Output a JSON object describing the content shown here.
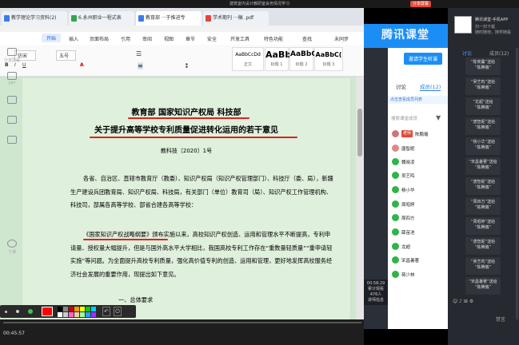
{
  "window_title": "建筑室内设计教研室会务情况学习",
  "window_button": "分享屏幕",
  "tabs": [
    {
      "label": "教学理论学习资料(2)"
    },
    {
      "label": "6.永州职业一程式表"
    },
    {
      "label": "教育部 ···于推进专"
    },
    {
      "label": "学术期刊 ···稿 .pdf"
    }
  ],
  "menu": {
    "items": [
      "开始",
      "插入",
      "页面布局",
      "引用",
      "审阅",
      "视图",
      "章节",
      "安全",
      "开发工具",
      "特色功能",
      "查找",
      "未同步"
    ]
  },
  "ribbon": {
    "font_name": "仿宋",
    "font_size": "五号",
    "styles": [
      {
        "preview": "AaBbCcDd",
        "name": "正文"
      },
      {
        "preview": "AaBb",
        "name": "标题 1"
      },
      {
        "preview": "AaBbC",
        "name": "标题 2"
      },
      {
        "preview": "AaBbC(",
        "name": "标题 3"
      }
    ]
  },
  "document": {
    "title1": "教育部 国家知识产权局 科技部",
    "title2": "关于提升高等学校专利质量促进转化运用的若干意见",
    "doc_no": "教科技〔2020〕1号",
    "para1": "各省、自治区、直辖市教育厅（教委）、知识产权局（知识产权管理部门）、科技厅（委、局），新疆生产建设兵团教育局、知识产权局、科技局，有关部门（单位）教育司（局）、知识产权工作管理机构、科技司，部属各高等学校、部省合建各高等学校：",
    "para2": "《国家知识产权战略纲要》颁布实施以来，高校知识产权创造、运用和管理水平不断提高，专利申请量、授权量大幅提升，但是与国外高水平大学相比，我国高校专利工作存在“重数量轻质量”“重申请轻实施”等问题。为全面提升高校专利质量，强化高价值专利的创造、运用和管理，更好地发挥高校服务经济社会发展的重要作用，现提出如下意见。",
    "section": "一、总体要求"
  },
  "video": {
    "elapsed": "00:45:57",
    "progress": 0.0
  },
  "classroom": {
    "brand": "腾讯课堂",
    "invite_button": "邀请学生听课",
    "left_tools": [
      "分享屏幕",
      "PPT",
      "视频",
      "播放",
      "画笔",
      "麦克风",
      "音乐",
      "设置",
      "下课"
    ],
    "live_time": "00:58:29",
    "live_text1": "累计观看",
    "live_text2": "476人",
    "live_text3": "讲师信息",
    "tab_discuss": "讨论",
    "tab_members": "成员(12)",
    "notice": "点击查看成员列表",
    "search_placeholder": "搜索课堂成员",
    "members": [
      {
        "tag": "老师",
        "name": "陈鹏儀"
      },
      {
        "name": "唐智妮"
      },
      {
        "name": "魏晓凌"
      },
      {
        "name": "吴艺鸣"
      },
      {
        "name": "杨小华"
      },
      {
        "name": "周昭婷"
      },
      {
        "name": "周四方"
      },
      {
        "name": "薛苗池"
      },
      {
        "name": "龙超"
      },
      {
        "name": "宋昌暑著"
      },
      {
        "name": "蒋少林"
      }
    ]
  },
  "right_panel": {
    "title": "腾讯课堂-手机APP",
    "subtitle1": "扫一扫下载",
    "subtitle2": "随时随地，随学随看",
    "tab_discuss": "讨论",
    "tab_members": "成员(12)",
    "messages": [
      {
        "line1": "“陈奕馨”送给",
        "line2": "“陈腾儀”"
      },
      {
        "line1": "“吴艺鸣”送给",
        "line2": "“陈腾儀”"
      },
      {
        "line1": "“龙超”送给",
        "line2": "“陈腾儀”"
      },
      {
        "line1": "“唐智妮”送给",
        "line2": "“陈腾儀”"
      },
      {
        "line1": "“杨小华”送给",
        "line2": "“陈腾儀”"
      },
      {
        "line1": "“宋昌暑著”送给",
        "line2": "“陈腾儀”"
      },
      {
        "line1": "“唐智妮”送给",
        "line2": "“陈腾儀”"
      },
      {
        "line1": "“周四方”送给",
        "line2": "“陈腾儀”"
      },
      {
        "line1": "“周昭婷”送给",
        "line2": "“陈腾儀”"
      },
      {
        "line1": "“唐智妮”送给",
        "line2": "“陈腾儀”"
      },
      {
        "line1": "“吴艺鸣”送给",
        "line2": "“陈腾儀”"
      },
      {
        "line1": "“宋昌暑著”送给",
        "line2": "“陈腾儀”"
      }
    ],
    "bottom_label": "禁言"
  }
}
